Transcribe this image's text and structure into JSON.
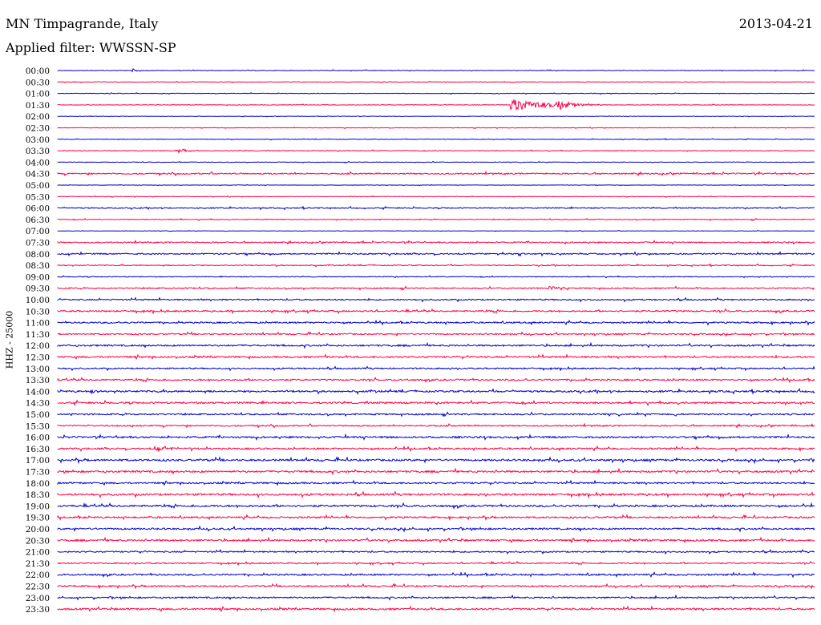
{
  "header": {
    "station": "MN Timpagrande, Italy",
    "filter_label": "Applied filter: WWSSN-SP",
    "date": "2013-04-21"
  },
  "chart_data": {
    "type": "line",
    "title": "MN Timpagrande, Italy",
    "subtitle": "Applied filter: WWSSN-SP",
    "date": "2013-04-21",
    "ylabel": "HHZ - 25000",
    "colors": [
      "#0000cc",
      "#ff0044"
    ],
    "row_labels": [
      "00:00",
      "00:30",
      "01:00",
      "01:30",
      "02:00",
      "02:30",
      "03:00",
      "03:30",
      "04:00",
      "04:30",
      "05:00",
      "05:30",
      "06:00",
      "06:30",
      "07:00",
      "07:30",
      "08:00",
      "08:30",
      "09:00",
      "09:30",
      "10:00",
      "10:30",
      "11:00",
      "11:30",
      "12:00",
      "12:30",
      "13:00",
      "13:30",
      "14:00",
      "14:30",
      "15:00",
      "15:30",
      "16:00",
      "16:30",
      "17:00",
      "17:30",
      "18:00",
      "18:30",
      "19:00",
      "19:30",
      "20:00",
      "20:30",
      "21:00",
      "21:30",
      "22:00",
      "22:30",
      "23:00",
      "23:30"
    ],
    "noise_level": [
      0.4,
      0.4,
      0.4,
      0.4,
      0.3,
      0.4,
      0.4,
      0.5,
      0.4,
      1.0,
      0.3,
      0.4,
      0.8,
      0.6,
      0.3,
      0.9,
      1.0,
      0.7,
      0.6,
      0.9,
      1.0,
      1.1,
      1.1,
      1.0,
      1.2,
      1.2,
      1.0,
      1.2,
      1.3,
      1.3,
      1.1,
      1.0,
      1.3,
      1.2,
      1.4,
      1.4,
      1.2,
      1.4,
      1.4,
      1.2,
      1.3,
      1.3,
      1.0,
      0.9,
      1.2,
      1.1,
      1.1,
      1.3
    ],
    "events": [
      {
        "row": 0,
        "x": 0.1,
        "amp": 3,
        "width": 0.004
      },
      {
        "row": 3,
        "x": 0.6,
        "amp": 9,
        "width": 0.04
      },
      {
        "row": 3,
        "x": 0.66,
        "amp": 6,
        "width": 0.02
      },
      {
        "row": 7,
        "x": 0.16,
        "amp": 4,
        "width": 0.01
      },
      {
        "row": 19,
        "x": 0.65,
        "amp": 3,
        "width": 0.008
      },
      {
        "row": 28,
        "x": 0.045,
        "amp": 4,
        "width": 0.004
      },
      {
        "row": 33,
        "x": 0.13,
        "amp": 3,
        "width": 0.02
      }
    ]
  }
}
